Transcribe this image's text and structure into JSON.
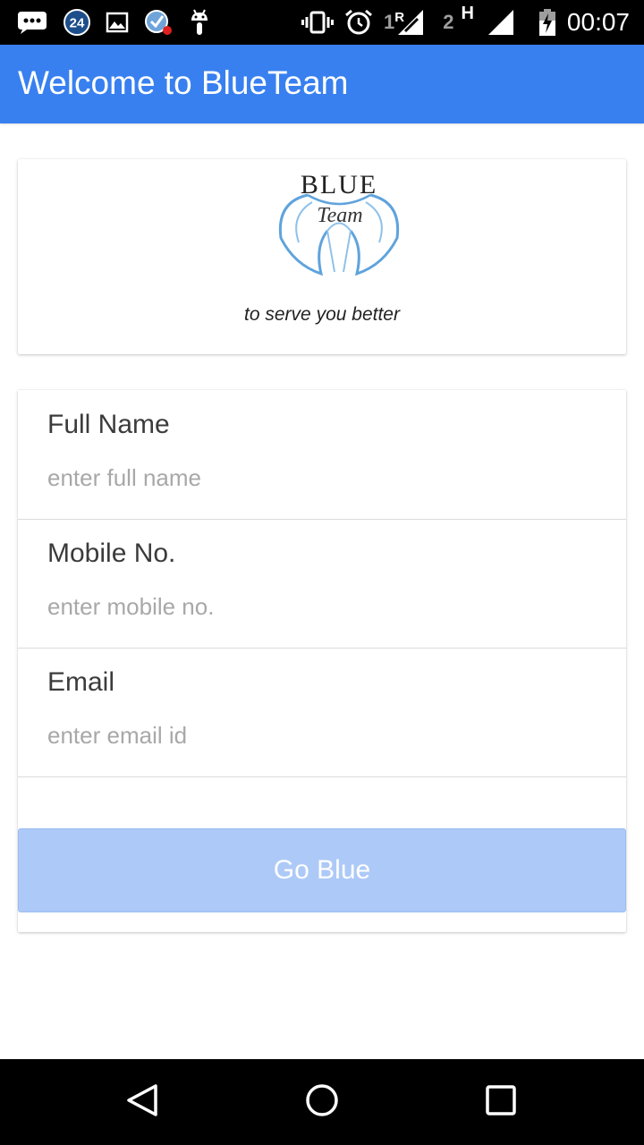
{
  "status_bar": {
    "notification_count": "24",
    "sim1_number": "1",
    "sim1_tag": "R",
    "sim2_number": "2",
    "sim2_tag": "H",
    "time": "00:07",
    "icons": [
      "chat-icon",
      "count-badge-icon",
      "image-icon",
      "sync-error-icon",
      "android-icon",
      "vibrate-icon",
      "alarm-icon",
      "signal-icon",
      "battery-icon"
    ]
  },
  "app_bar": {
    "title": "Welcome to BlueTeam",
    "color": "#3880f0"
  },
  "logo_card": {
    "logo_word_top": "BLUE",
    "logo_word_bottom": "Team",
    "tagline": "to serve you better"
  },
  "form": {
    "full_name": {
      "label": "Full Name",
      "value": "",
      "placeholder": "enter full name"
    },
    "mobile": {
      "label": "Mobile No.",
      "value": "",
      "placeholder": "enter mobile no."
    },
    "email": {
      "label": "Email",
      "value": "",
      "placeholder": "enter email id"
    },
    "submit_label": "Go Blue",
    "submit_color": "#adc9f7"
  },
  "nav_bar": {
    "icons": [
      "back-icon",
      "home-icon",
      "recents-icon"
    ]
  }
}
